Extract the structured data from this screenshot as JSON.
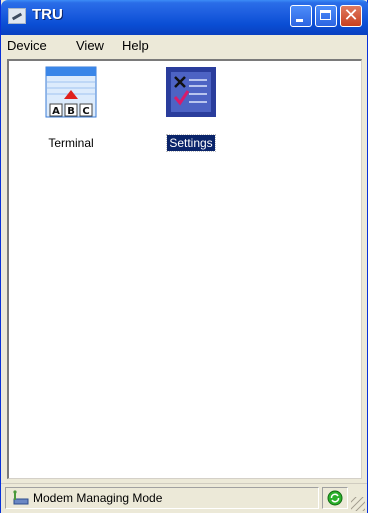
{
  "window": {
    "title": "TRU"
  },
  "menu": {
    "items": [
      "Device",
      "View",
      "Help"
    ]
  },
  "icons": [
    {
      "label": "Terminal",
      "icon": "terminal-abc-icon",
      "selected": false
    },
    {
      "label": "Settings",
      "icon": "settings-checklist-icon",
      "selected": true
    }
  ],
  "status": {
    "text": "Modem Managing Mode",
    "left_icon": "modem-icon",
    "right_icon": "connection-status-icon"
  },
  "colors": {
    "titlebar": "#0a4ed4",
    "selection": "#0a246a",
    "status_ok": "#2bb02b"
  }
}
